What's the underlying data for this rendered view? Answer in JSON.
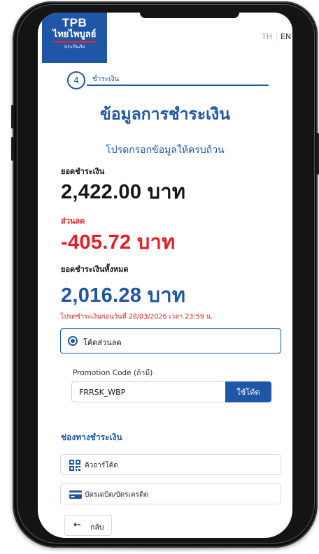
{
  "brand": {
    "logo_top": "TPB",
    "logo_name": "ไทยไพบูลย์",
    "logo_sub": "ประกันภัย",
    "color_primary": "#1f56a8",
    "color_danger": "#e31e25"
  },
  "language": {
    "th": "TH",
    "en": "EN",
    "selected": "EN"
  },
  "step": {
    "number": "4",
    "label": "ชำระเงิน"
  },
  "page": {
    "title": "ข้อมูลการชำระเงิน",
    "subtitle": "โปรดกรอกข้อมูลให้ครบถ้วน"
  },
  "summary": {
    "payment_label": "ยอดชำระเงิน",
    "payment_amount": "2,422.00 บาท",
    "discount_label": "ส่วนลด",
    "discount_amount": "-405.72 บาท",
    "total_label": "ยอดชำระเงินทั้งหมด",
    "total_amount": "2,016.28 บาท",
    "due_note": "โปรดชำระเงินก่อนวันที่ 28/03/2026 เวลา 23:59 น."
  },
  "promotion": {
    "option_label": "โค้ดส่วนลด",
    "selected": true,
    "field_label": "Promotion Code (ถ้ามี)",
    "code_value": "FRRSK_WBP",
    "apply_button": "ใช้โค้ด"
  },
  "payment_channels": {
    "title": "ช่องทางชำระเงิน",
    "items": [
      {
        "label": "คิวอาร์โค้ด",
        "icon": "qr-code-icon"
      },
      {
        "label": "บัตรเดบิต/บัตรเครดิต",
        "icon": "credit-card-icon"
      }
    ]
  },
  "navigation": {
    "back_label": "กลับ",
    "back_icon": "arrow-left-icon"
  }
}
